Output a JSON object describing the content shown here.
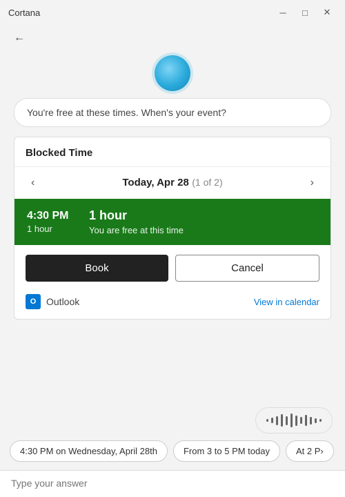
{
  "titleBar": {
    "title": "Cortana",
    "minimize": "─",
    "maximize": "□",
    "close": "✕"
  },
  "back": "‹",
  "avatar": {
    "ariaLabel": "Cortana avatar"
  },
  "messageBubble": {
    "text": "You're free at these times. When's your event?"
  },
  "card": {
    "headerTitle": "Blocked Time",
    "navPrev": "‹",
    "navNext": "›",
    "navDate": "Today, Apr 28",
    "navCount": "(1 of 2)",
    "timeSlot": {
      "time": "4:30 PM",
      "durationLeft": "1 hour",
      "duration": "1 hour",
      "freeText": "You are free at this time"
    },
    "bookLabel": "Book",
    "cancelLabel": "Cancel",
    "outlookLabel": "Outlook",
    "viewCalendarLabel": "View in calendar"
  },
  "waveform": {
    "bars": [
      2,
      5,
      8,
      12,
      9,
      14,
      10,
      7,
      11,
      8,
      5,
      3
    ]
  },
  "chips": [
    {
      "label": "4:30 PM on Wednesday, April 28th"
    },
    {
      "label": "From 3 to 5 PM today"
    },
    {
      "label": "At 2 P›"
    }
  ],
  "inputPlaceholder": "Type your answer"
}
